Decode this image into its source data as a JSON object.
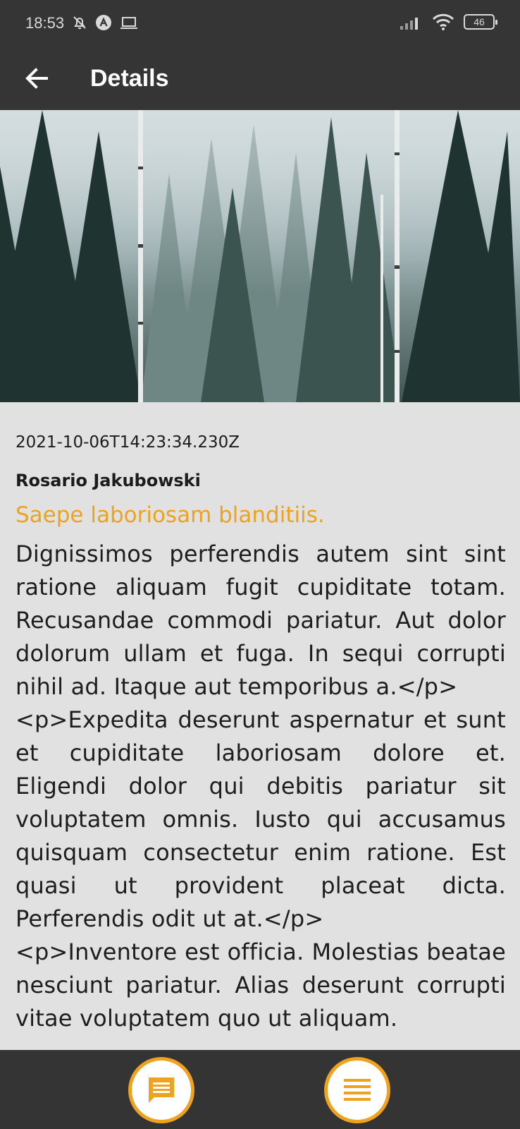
{
  "status_bar": {
    "time": "18:53",
    "battery": "46",
    "icons": [
      "muted-bell-icon",
      "a-badge-icon",
      "laptop-icon",
      "signal-icon",
      "wifi-icon",
      "battery-icon"
    ]
  },
  "app_bar": {
    "title": "Details",
    "back_icon": "arrow-left-icon"
  },
  "post": {
    "image": "forest-photo",
    "date": "2021-10-06T14:23:34.230Z",
    "author": "Rosario Jakubowski",
    "title": "Saepe laboriosam blanditiis.",
    "body": "Dignissimos perferendis autem sint sint ratione aliquam fugit cupiditate totam. Recusandae commodi pariatur. Aut dolor dolorum ullam et fuga. In sequi corrupti nihil ad. Itaque aut temporibus a.</p>\n<p>Expedita deserunt aspernatur et sunt et cupiditate laboriosam dolore et. Eligendi dolor qui debitis pariatur sit voluptatem omnis. Iusto qui accusamus quisquam consectetur enim ratione. Est quasi ut provident placeat dicta. Perferendis odit ut at.</p>\n<p>Inventore est officia. Molestias beatae nesciunt pariatur. Alias deserunt corrupti vitae voluptatem quo ut aliquam."
  },
  "bottom_bar": {
    "buttons": [
      {
        "icon": "comment-icon"
      },
      {
        "icon": "menu-icon"
      }
    ]
  },
  "colors": {
    "accent": "#eea21d",
    "bar_background": "#353535",
    "content_background": "#e1e1e1"
  }
}
